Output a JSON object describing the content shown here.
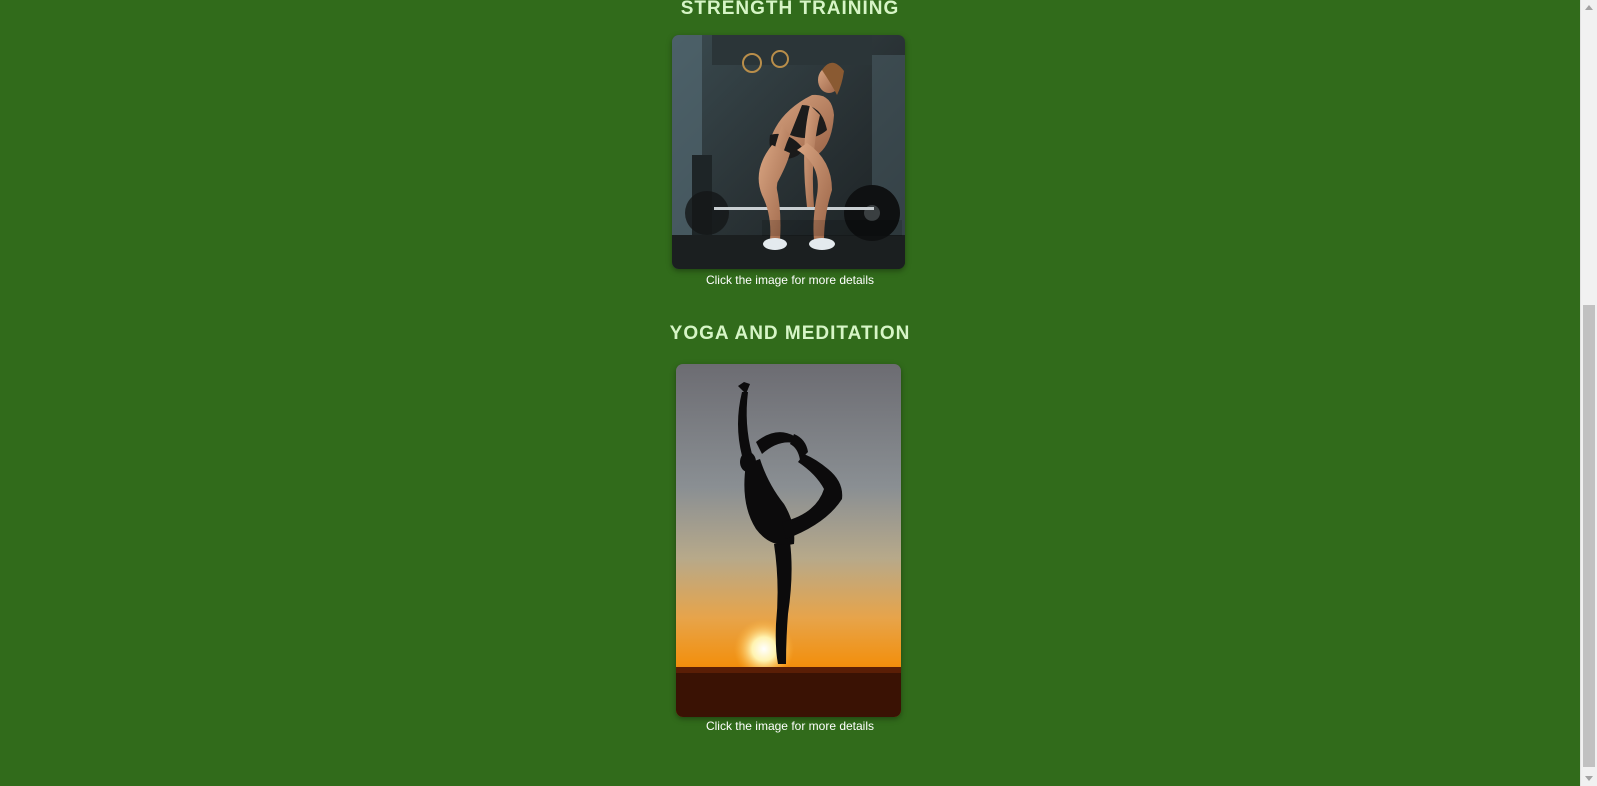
{
  "sections": [
    {
      "title": "STRENGTH TRAINING",
      "image_alt": "Woman performing a barbell deadlift in a gym",
      "caption": "Click the image for more details"
    },
    {
      "title": "YOGA AND MEDITATION",
      "image_alt": "Silhouette of a person in a yoga dancer pose at sunset",
      "caption": "Click the image for more details"
    }
  ],
  "colors": {
    "background": "#316b1b",
    "title": "#d6f5c6",
    "caption": "#ffffff"
  }
}
